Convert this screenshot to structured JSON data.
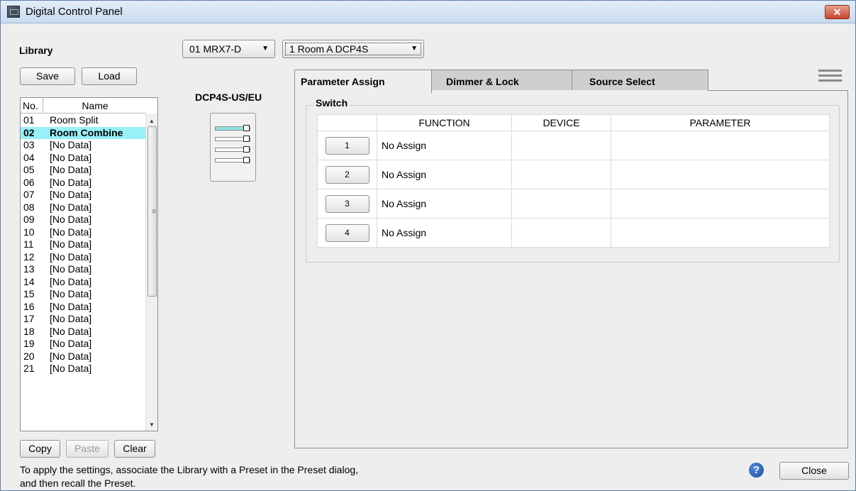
{
  "window": {
    "title": "Digital Control Panel",
    "close_glyph": "✕"
  },
  "library": {
    "label": "Library",
    "save_label": "Save",
    "load_label": "Load",
    "col_no": "No.",
    "col_name": "Name",
    "items": [
      {
        "no": "01",
        "name": "Room Split"
      },
      {
        "no": "02",
        "name": "Room Combine",
        "selected": true
      },
      {
        "no": "03",
        "name": "[No Data]"
      },
      {
        "no": "04",
        "name": "[No Data]"
      },
      {
        "no": "05",
        "name": "[No Data]"
      },
      {
        "no": "06",
        "name": "[No Data]"
      },
      {
        "no": "07",
        "name": "[No Data]"
      },
      {
        "no": "08",
        "name": "[No Data]"
      },
      {
        "no": "09",
        "name": "[No Data]"
      },
      {
        "no": "10",
        "name": "[No Data]"
      },
      {
        "no": "11",
        "name": "[No Data]"
      },
      {
        "no": "12",
        "name": "[No Data]"
      },
      {
        "no": "13",
        "name": "[No Data]"
      },
      {
        "no": "14",
        "name": "[No Data]"
      },
      {
        "no": "15",
        "name": "[No Data]"
      },
      {
        "no": "16",
        "name": "[No Data]"
      },
      {
        "no": "17",
        "name": "[No Data]"
      },
      {
        "no": "18",
        "name": "[No Data]"
      },
      {
        "no": "19",
        "name": "[No Data]"
      },
      {
        "no": "20",
        "name": "[No Data]"
      },
      {
        "no": "21",
        "name": "[No Data]"
      }
    ],
    "copy_label": "Copy",
    "paste_label": "Paste",
    "clear_label": "Clear"
  },
  "device_selector": {
    "device_value": "01 MRX7-D",
    "dcp_value": "1 Room A DCP4S"
  },
  "device_model_label": "DCP4S-US/EU",
  "tabs": [
    {
      "label": "Parameter Assign",
      "active": true
    },
    {
      "label": "Dimmer & Lock",
      "active": false
    },
    {
      "label": "Source Select",
      "active": false
    }
  ],
  "switch_group": {
    "label": "Switch",
    "columns": {
      "function": "FUNCTION",
      "device": "DEVICE",
      "parameter": "PARAMETER"
    },
    "rows": [
      {
        "button": "1",
        "function": "No Assign",
        "device": "",
        "parameter": ""
      },
      {
        "button": "2",
        "function": "No Assign",
        "device": "",
        "parameter": ""
      },
      {
        "button": "3",
        "function": "No Assign",
        "device": "",
        "parameter": ""
      },
      {
        "button": "4",
        "function": "No Assign",
        "device": "",
        "parameter": ""
      }
    ]
  },
  "footer": {
    "hint_line1": "To apply the settings, associate the Library with a Preset in the Preset dialog,",
    "hint_line2": "and then recall the Preset.",
    "help_glyph": "?",
    "close_label": "Close"
  },
  "icons": {
    "app": "control-panel-icon",
    "menu": "hamburger-menu-icon",
    "help": "help-icon"
  }
}
